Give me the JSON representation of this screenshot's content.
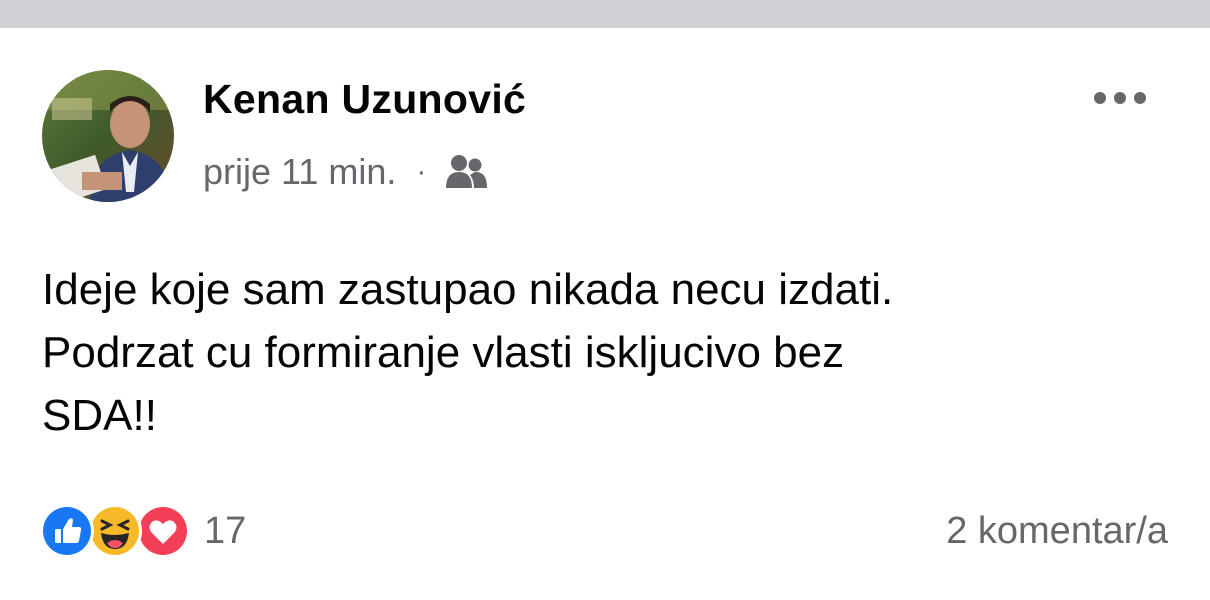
{
  "post": {
    "author": "Kenan Uzunović",
    "timestamp": "prije 11 min.",
    "separator": "·",
    "audience_icon": "friends-icon",
    "more_icon": "more-options-icon",
    "text_lines": [
      "Ideje koje sam zastupao nikada necu izdati.",
      "Podrzat cu formiranje vlasti iskljucivo bez",
      "SDA!!"
    ]
  },
  "footer": {
    "reactions": [
      "like",
      "haha",
      "love"
    ],
    "reaction_count": "17",
    "comments_label": "2 komentar/a"
  },
  "colors": {
    "top_bar": "#cfd1d6",
    "secondary_text": "#65676b",
    "primary_text": "#050505",
    "like_blue": "#1877f2",
    "haha_yellow": "#f7b928",
    "love_red": "#f33e58"
  }
}
